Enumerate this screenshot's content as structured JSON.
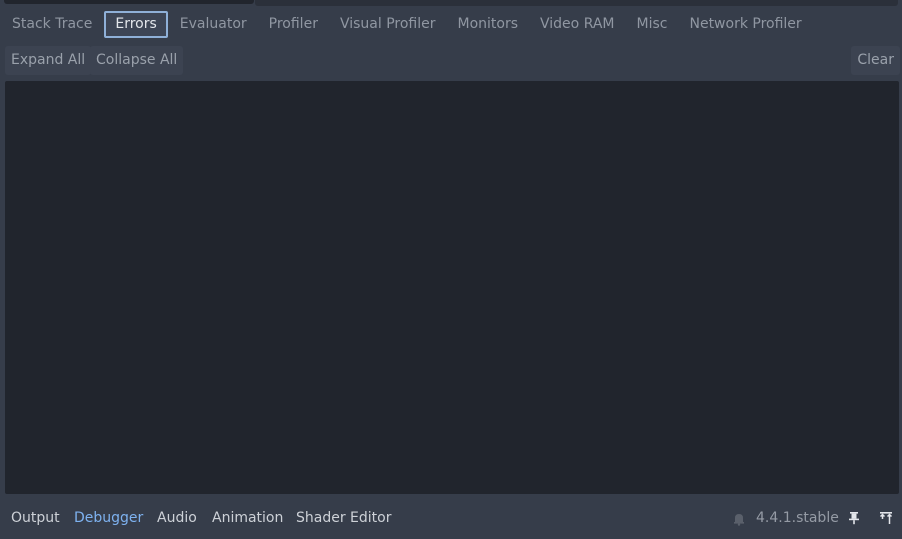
{
  "debugger_tabs": [
    {
      "label": "Stack Trace"
    },
    {
      "label": "Errors"
    },
    {
      "label": "Evaluator"
    },
    {
      "label": "Profiler"
    },
    {
      "label": "Visual Profiler"
    },
    {
      "label": "Monitors"
    },
    {
      "label": "Video RAM"
    },
    {
      "label": "Misc"
    },
    {
      "label": "Network Profiler"
    }
  ],
  "active_tab": "Errors",
  "toolbar": {
    "expand_all": "Expand All",
    "collapse_all": "Collapse All",
    "clear": "Clear"
  },
  "bottom_panel": {
    "tabs": [
      "Output",
      "Debugger",
      "Audio",
      "Animation",
      "Shader Editor"
    ],
    "active": "Debugger",
    "version": "4.4.1.stable",
    "icons": [
      "notification-bell-icon",
      "pin-icon",
      "expand-panel-icon"
    ]
  },
  "colors": {
    "background": "#363d4a",
    "panel": "#21252d",
    "accent": "#7eb2f0",
    "active_tab_border": "#8fb0d8"
  }
}
